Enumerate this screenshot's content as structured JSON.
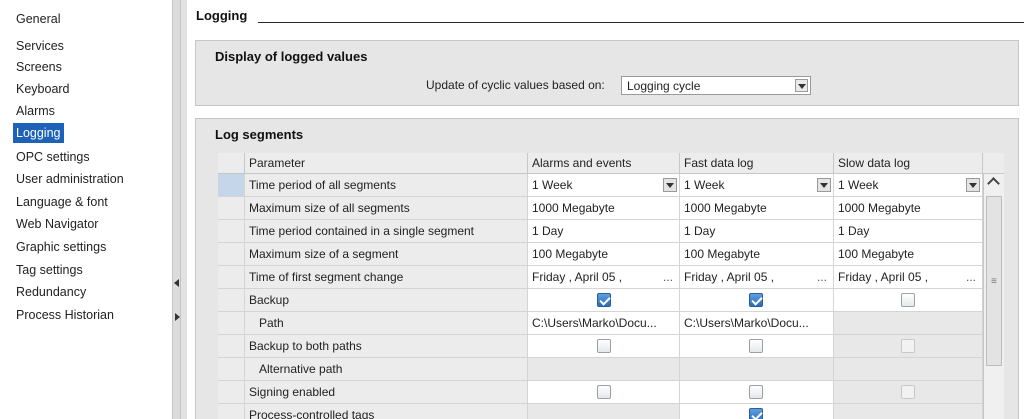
{
  "sidebar": {
    "items": [
      {
        "label": "General"
      },
      {
        "label": "Services"
      },
      {
        "label": "Screens"
      },
      {
        "label": "Keyboard"
      },
      {
        "label": "Alarms"
      },
      {
        "label": "Logging"
      },
      {
        "label": "OPC settings"
      },
      {
        "label": "User administration"
      },
      {
        "label": "Language & font"
      },
      {
        "label": "Web Navigator"
      },
      {
        "label": "Graphic settings"
      },
      {
        "label": "Tag settings"
      },
      {
        "label": "Redundancy"
      },
      {
        "label": "Process Historian"
      }
    ],
    "selected_index": 5
  },
  "header": {
    "title": "Logging"
  },
  "display_group": {
    "title": "Display of logged values",
    "update_label": "Update of cyclic values based on:",
    "update_value": "Logging cycle"
  },
  "segments_group": {
    "title": "Log segments",
    "columns": [
      "Parameter",
      "Alarms and events",
      "Fast data log",
      "Slow data log"
    ],
    "rows": [
      {
        "param": "Time period of all segments",
        "c1": "1 Week",
        "c2": "1 Week",
        "c3": "1 Week"
      },
      {
        "param": "Maximum size of all segments",
        "c1": "1000 Megabyte",
        "c2": "1000 Megabyte",
        "c3": "1000 Megabyte"
      },
      {
        "param": "Time period contained in a single segment",
        "c1": "1 Day",
        "c2": "1 Day",
        "c3": "1 Day"
      },
      {
        "param": "Maximum size of a segment",
        "c1": "100 Megabyte",
        "c2": "100 Megabyte",
        "c3": "100 Megabyte"
      },
      {
        "param": "Time of first segment change",
        "c1": "Friday , April  05 ,",
        "c2": "Friday , April  05 ,",
        "c3": "Friday , April  05 ,",
        "ellipsis": "..."
      },
      {
        "param": "Backup",
        "c1_checked": true,
        "c2_checked": true,
        "c3_checked": false
      },
      {
        "param": "Path",
        "c1": "C:\\Users\\Marko\\Docu...",
        "c2": "C:\\Users\\Marko\\Docu...",
        "c3": ""
      },
      {
        "param": "Backup to both paths",
        "c1_checked": false,
        "c2_checked": false,
        "c3_checked": false
      },
      {
        "param": "Alternative path",
        "c1": "",
        "c2": "",
        "c3": ""
      },
      {
        "param": "Signing enabled",
        "c1_checked": false,
        "c2_checked": false,
        "c3_checked": false
      },
      {
        "param": "Process-controlled tags",
        "c2_checked": true
      }
    ]
  },
  "colors": {
    "selection": "#1e62b8",
    "panel": "#e6e6e6",
    "checkbox_checked": "#2c6cb8"
  },
  "icons": {
    "dropdown": "chevron-down-icon",
    "scroll_up": "scroll-up-icon",
    "checkbox": "checkbox-icon"
  }
}
